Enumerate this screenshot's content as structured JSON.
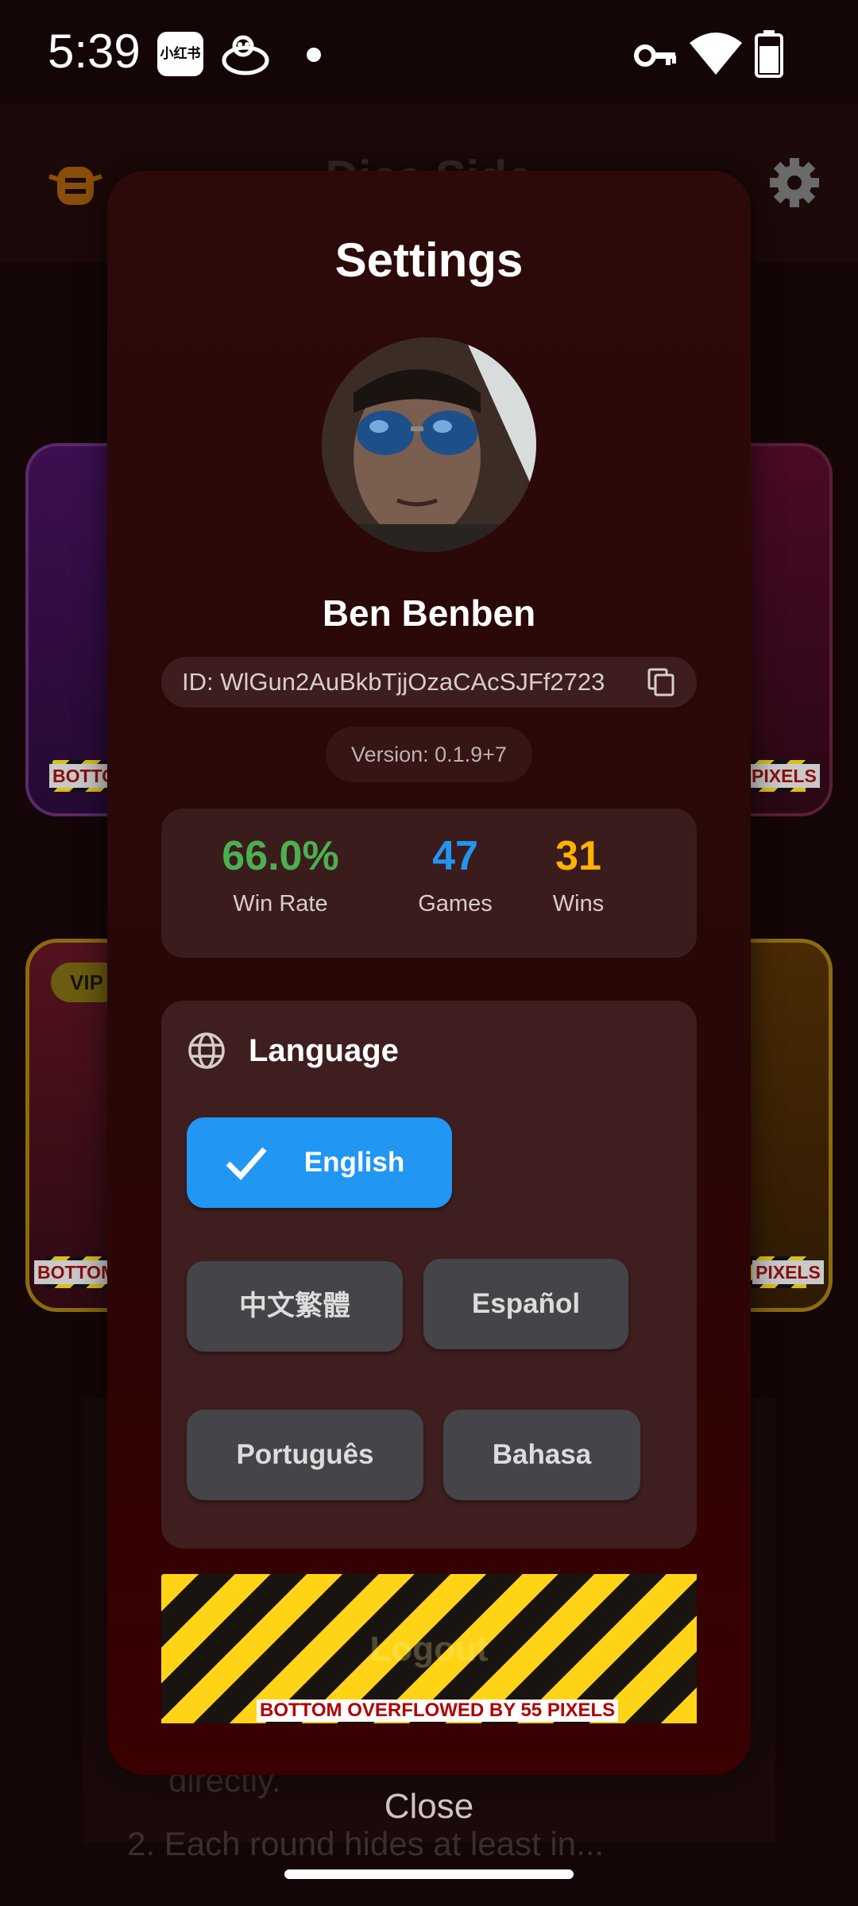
{
  "status_bar": {
    "time": "5:39",
    "notification_app_label": "小红书",
    "icons": [
      "xiaohongshu-app-icon",
      "game-app-icon",
      "notification-dot-icon",
      "vpn-key-icon",
      "wifi-icon",
      "battery-icon"
    ]
  },
  "background": {
    "app_title": "Dice Side",
    "vip_label": "VIP",
    "card_overflow_left": "BOTTO",
    "card_overflow_right": "PIXELS",
    "card_overflow_left2": "BOTTOM",
    "card_overflow_right2": "PIXELS",
    "text_line1": "directly.",
    "text_line2": "2. Each round hides at least in..."
  },
  "settings": {
    "title": "Settings",
    "user_name": "Ben Benben",
    "user_id": "ID: WlGun2AuBkbTjjOzaCAcSJFf2723",
    "version": "Version: 0.1.9+7",
    "stats": [
      {
        "value": "66.0%",
        "label": "Win Rate",
        "color": "#4caf50"
      },
      {
        "value": "47",
        "label": "Games",
        "color": "#2196f3"
      },
      {
        "value": "31",
        "label": "Wins",
        "color": "#ffb300"
      }
    ],
    "language": {
      "title": "Language",
      "options": [
        {
          "label": "English",
          "selected": true
        },
        {
          "label": "中文繁體",
          "selected": false
        },
        {
          "label": "Español",
          "selected": false
        },
        {
          "label": "Português",
          "selected": false
        },
        {
          "label": "Bahasa",
          "selected": false
        }
      ]
    },
    "logout_label": "Logout",
    "overflow_warning": "BOTTOM OVERFLOWED BY 55 PIXELS",
    "close_label": "Close"
  },
  "colors": {
    "accent": "#2196f3",
    "win_rate": "#4caf50",
    "wins": "#ffb300",
    "dialog_bg": "#2d0a0a"
  }
}
